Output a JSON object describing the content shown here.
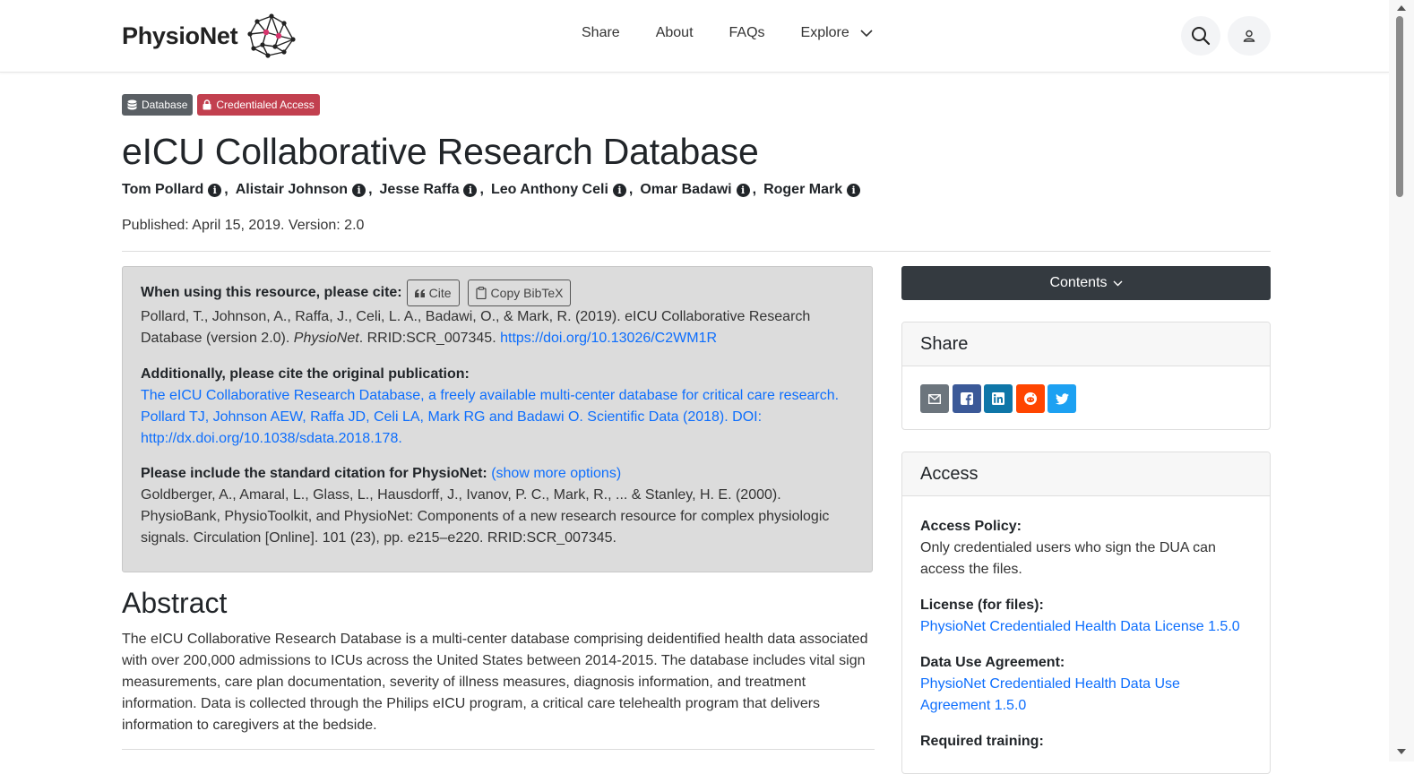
{
  "header": {
    "logo_text": "PhysioNet",
    "nav": [
      "Share",
      "About",
      "FAQs",
      "Explore"
    ],
    "search_icon": "search-icon",
    "account_icon": "user-icon"
  },
  "badges": {
    "database": "Database",
    "credentialed": "Credentialed Access"
  },
  "title": "eICU Collaborative Research Database",
  "authors": [
    "Tom Pollard",
    "Alistair Johnson",
    "Jesse Raffa",
    "Leo Anthony Celi",
    "Omar Badawi",
    "Roger Mark"
  ],
  "published": "Published: April 15, 2019. Version: 2.0",
  "cite": {
    "heading": "When using this resource, please cite:",
    "cite_button": "Cite",
    "bibtex_button": "Copy BibTeX",
    "citation_text": "Pollard, T., Johnson, A., Raffa, J., Celi, L. A., Badawi, O., & Mark, R. (2019). eICU Collaborative Research Database (version 2.0).",
    "citation_journal": "PhysioNet",
    "citation_rrid": ". RRID:SCR_007345.",
    "citation_doi": "https://doi.org/10.13026/C2WM1R",
    "original_heading": "Additionally, please cite the original publication:",
    "original_link": "The eICU Collaborative Research Database, a freely available multi-center database for critical care research. Pollard TJ, Johnson AEW, Raffa JD, Celi LA, Mark RG and Badawi O. Scientific Data (2018). DOI: http://dx.doi.org/10.1038/sdata.2018.178.",
    "standard_heading": "Please include the standard citation for PhysioNet:",
    "show_more": "(show more options)",
    "standard_text": "Goldberger, A., Amaral, L., Glass, L., Hausdorff, J., Ivanov, P. C., Mark, R., ... & Stanley, H. E. (2000). PhysioBank, PhysioToolkit, and PhysioNet: Components of a new research resource for complex physiologic signals. Circulation [Online]. 101 (23), pp. e215–e220. RRID:SCR_007345."
  },
  "abstract": {
    "heading": "Abstract",
    "text": "The eICU Collaborative Research Database is a multi-center database comprising deidentified health data associated with over 200,000 admissions to ICUs across the United States between 2014-2015. The database includes vital sign measurements, care plan documentation, severity of illness measures, diagnosis information, and treatment information. Data is collected through the Philips eICU program, a critical care telehealth program that delivers information to caregivers at the bedside."
  },
  "sidebar": {
    "contents_button": "Contents",
    "share_title": "Share",
    "share_buttons": [
      {
        "icon": "email-icon",
        "color": "#6c757d"
      },
      {
        "icon": "facebook-icon",
        "color": "#3b5998"
      },
      {
        "icon": "linkedin-icon",
        "color": "#0e76a8"
      },
      {
        "icon": "reddit-icon",
        "color": "#ff4500"
      },
      {
        "icon": "twitter-icon",
        "color": "#1da1f2"
      }
    ],
    "access_title": "Access",
    "access_policy_label": "Access Policy:",
    "access_policy_text": "Only credentialed users who sign the DUA can access the files.",
    "license_label": "License (for files):",
    "license_link": "PhysioNet Credentialed Health Data License 1.5.0",
    "dua_label": "Data Use Agreement:",
    "dua_link": "PhysioNet Credentialed Health Data Use Agreement 1.5.0",
    "training_label": "Required training:"
  }
}
